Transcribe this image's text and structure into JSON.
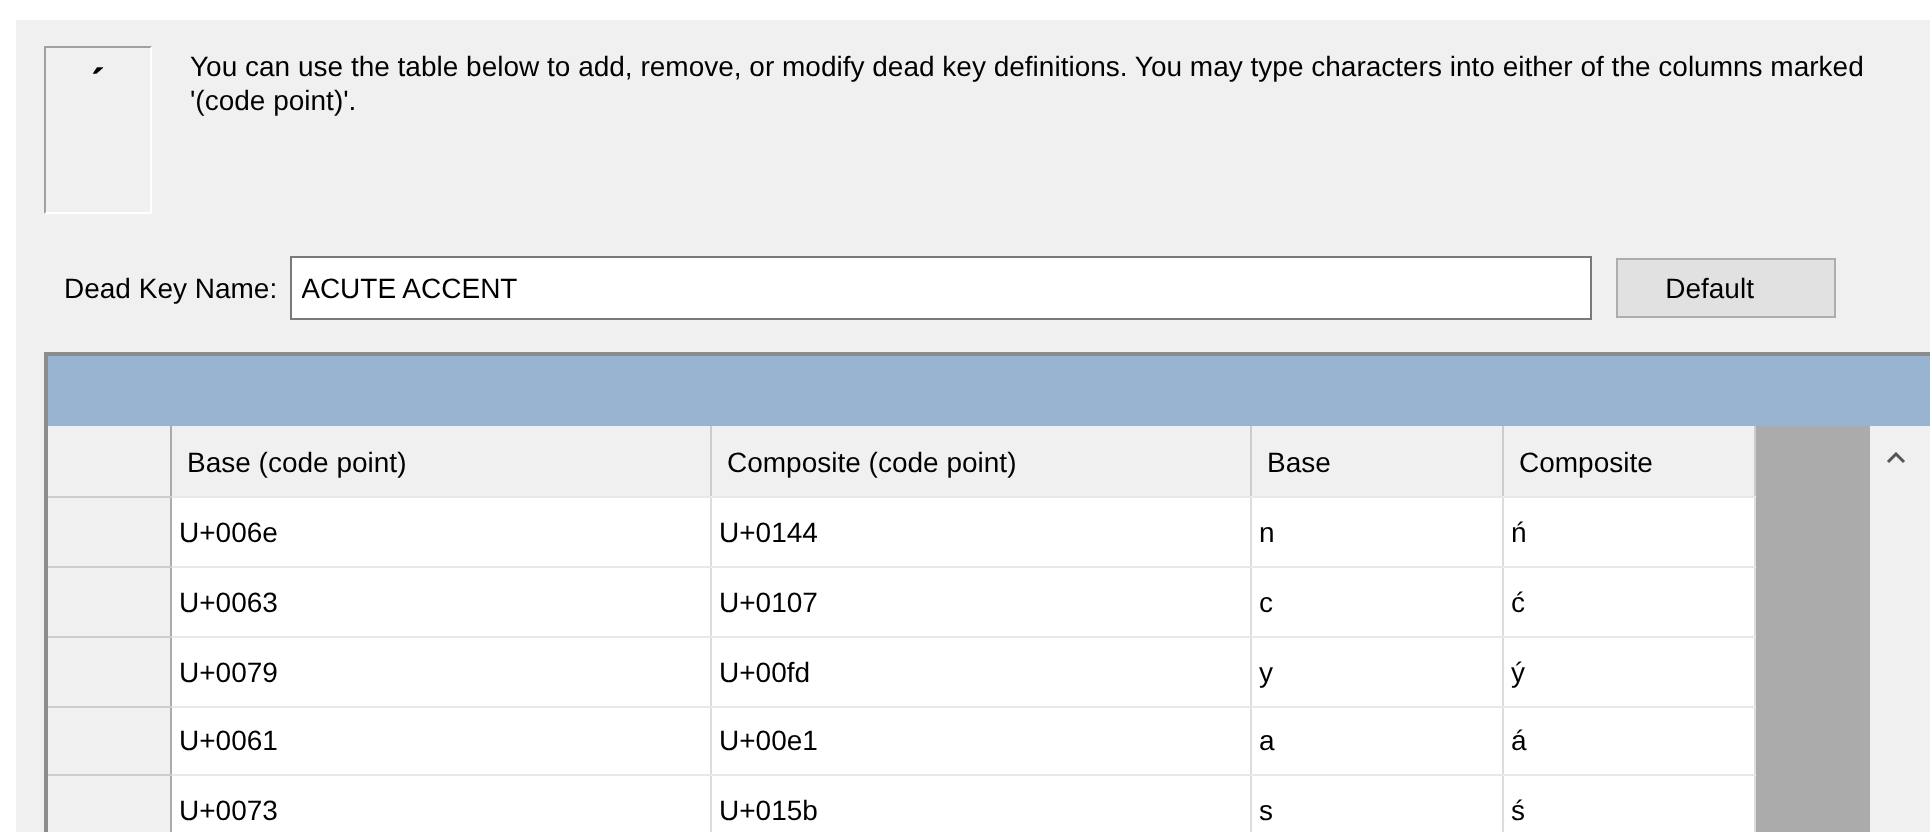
{
  "preview": {
    "character": "ˊ"
  },
  "description": "You can use the table below to add, remove, or modify dead key definitions.  You may type characters into either of the columns marked '(code point)'.",
  "name_field": {
    "label": "Dead Key Name:",
    "value": "ACUTE ACCENT"
  },
  "default_button": {
    "label": "Default"
  },
  "table": {
    "columns": [
      "Base  (code point)",
      "Composite (code point)",
      "Base",
      "Composite"
    ],
    "rows": [
      [
        "U+006e",
        "U+0144",
        "n",
        "ń"
      ],
      [
        "U+0063",
        "U+0107",
        "c",
        "ć"
      ],
      [
        "U+0079",
        "U+00fd",
        "y",
        "ý"
      ],
      [
        "U+0061",
        "U+00e1",
        "a",
        "á"
      ],
      [
        "U+0073",
        "U+015b",
        "s",
        "ś"
      ]
    ]
  }
}
